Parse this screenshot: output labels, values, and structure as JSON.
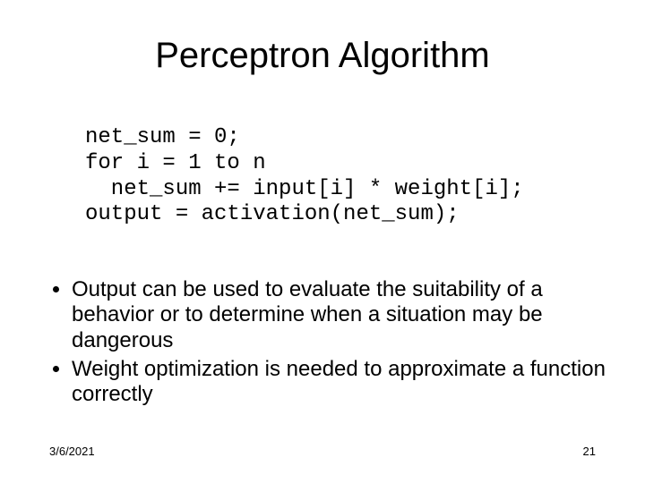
{
  "title": "Perceptron Algorithm",
  "code": {
    "l1": "net_sum = 0;",
    "l2": "for i = 1 to n",
    "l3": "  net_sum += input[i] * weight[i];",
    "l4": "output = activation(net_sum);"
  },
  "bullets": {
    "b1": "Output can be used to evaluate the suitability of a behavior or to determine when a situation may be dangerous",
    "b2": "Weight optimization is needed to approximate a function correctly"
  },
  "footer": {
    "date": "3/6/2021",
    "page": "21"
  }
}
